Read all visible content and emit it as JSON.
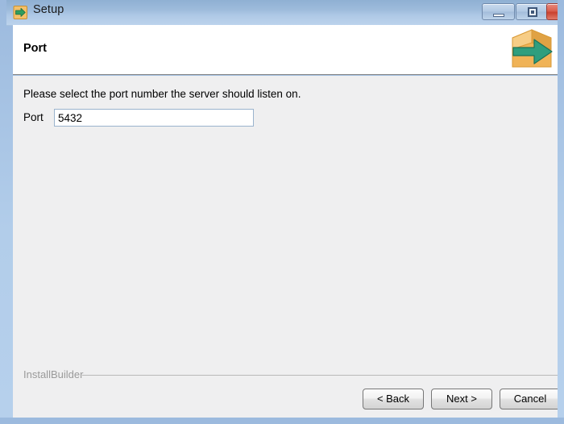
{
  "window": {
    "title": "Setup",
    "icon_name": "setup-arrow-icon",
    "controls": [
      {
        "name": "minimize-button",
        "glyph": "minimize",
        "label": "Minimize"
      },
      {
        "name": "maximize-button",
        "glyph": "maximize",
        "label": "Maximize"
      },
      {
        "name": "close-button",
        "glyph": "✕",
        "label": "Close"
      }
    ],
    "colors": {
      "titlebar_top": "#8fb0d3",
      "titlebar_bottom": "#bcd3ec",
      "frame": "#b2cdea",
      "body": "#efeff0",
      "header": "#ffffff",
      "close_button": "#c9412f",
      "brand_text": "#9a9a9a",
      "box_icon": "#f0b357",
      "arrow_icon": "#2f9e7e"
    }
  },
  "header": {
    "title": "Port",
    "icon_name": "package-arrow-icon"
  },
  "main": {
    "instruction": "Please select the port number the server should listen on.",
    "port_field": {
      "label": "Port",
      "value": "5432",
      "placeholder": ""
    }
  },
  "footer": {
    "brand": "InstallBuilder",
    "buttons": [
      {
        "name": "back-button",
        "label": "< Back"
      },
      {
        "name": "next-button",
        "label": "Next >"
      },
      {
        "name": "cancel-button",
        "label": "Cancel"
      }
    ]
  }
}
